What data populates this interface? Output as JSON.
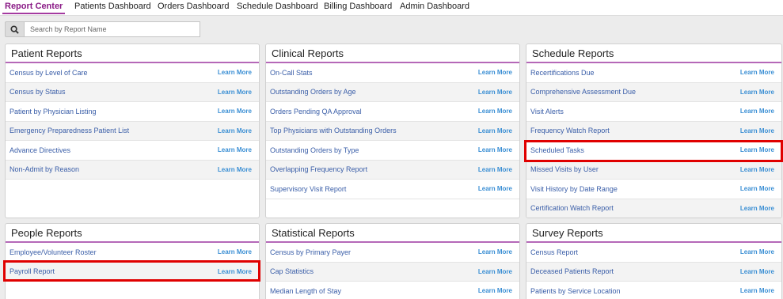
{
  "nav": {
    "tabs": [
      {
        "label": "Report Center"
      },
      {
        "label": "Patients Dashboard"
      },
      {
        "label": "Orders Dashboard"
      },
      {
        "label": "Schedule Dashboard"
      },
      {
        "label": "Billing Dashboard"
      },
      {
        "label": "Admin Dashboard"
      }
    ],
    "active_tab": "Report Center"
  },
  "search": {
    "placeholder": "Search by Report Name",
    "icon": "search-icon"
  },
  "learn_more_label": "Learn More",
  "colors": {
    "accent": "#a43aa0",
    "link": "#3a5ea8",
    "learn_more": "#3b8fd4",
    "highlight": "#e00000"
  },
  "panels": {
    "patient": {
      "title": "Patient Reports",
      "items": [
        "Census by Level of Care",
        "Census by Status",
        "Patient by Physician Listing",
        "Emergency Preparedness Patient List",
        "Advance Directives",
        "Non-Admit by Reason"
      ]
    },
    "clinical": {
      "title": "Clinical Reports",
      "items": [
        "On-Call Stats",
        "Outstanding Orders by Age",
        "Orders Pending QA Approval",
        "Top Physicians with Outstanding Orders",
        "Outstanding Orders by Type",
        "Overlapping Frequency Report",
        "Supervisory Visit Report"
      ]
    },
    "schedule": {
      "title": "Schedule Reports",
      "items": [
        "Recertifications Due",
        "Comprehensive Assessment Due",
        "Visit Alerts",
        "Frequency Watch Report",
        "Scheduled Tasks",
        "Missed Visits by User",
        "Visit History by Date Range",
        "Certification Watch Report"
      ]
    },
    "people": {
      "title": "People Reports",
      "items": [
        "Employee/Volunteer Roster",
        "Payroll Report"
      ]
    },
    "statistical": {
      "title": "Statistical Reports",
      "items": [
        "Census by Primary Payer",
        "Cap Statistics",
        "Median Length of Stay"
      ]
    },
    "survey": {
      "title": "Survey Reports",
      "items": [
        "Census Report",
        "Deceased Patients Report",
        "Patients by Service Location"
      ]
    }
  }
}
